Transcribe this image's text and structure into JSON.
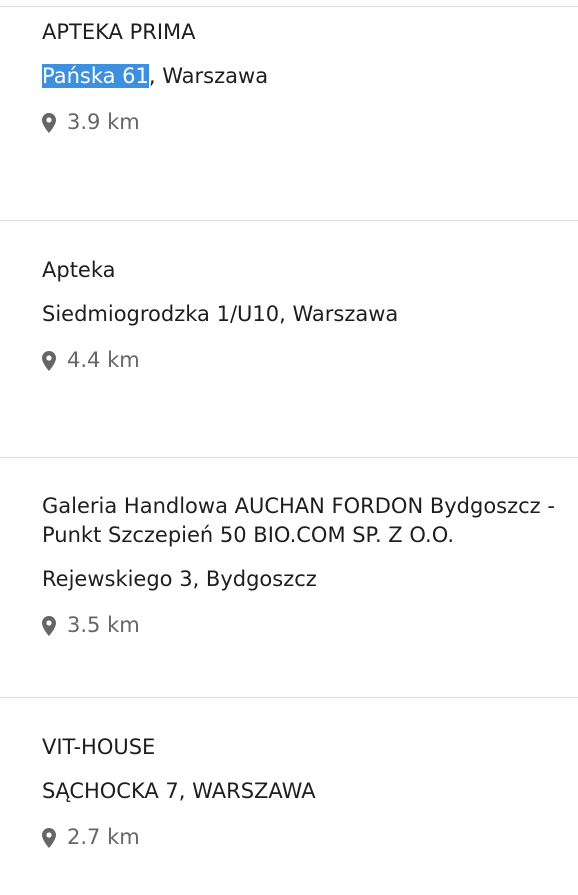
{
  "pharmacies": [
    {
      "name": "APTEKA PRIMA",
      "address_highlight": "Pańska 61",
      "address_rest": ", Warszawa",
      "distance": "3.9 km"
    },
    {
      "name": "Apteka",
      "address_highlight": "",
      "address_rest": "Siedmiogrodzka 1/U10, Warszawa",
      "distance": "4.4 km"
    },
    {
      "name_line1": "Galeria Handlowa AUCHAN FORDON Bydgoszcz -",
      "name_line2": "Punkt Szczepień 50 BIO.COM SP. Z O.O.",
      "address_highlight": "",
      "address_rest": "Rejewskiego 3, Bydgoszcz",
      "distance": "3.5 km"
    },
    {
      "name": "VIT-HOUSE",
      "address_highlight": "",
      "address_rest": "SĄCHOCKA 7, WARSZAWA",
      "distance": "2.7 km"
    }
  ],
  "icons": {
    "distance": "map-pin-icon"
  },
  "colors": {
    "selection_highlight": "#3d8fe0",
    "distance_text": "#666666",
    "divider": "#dcdcdc"
  }
}
